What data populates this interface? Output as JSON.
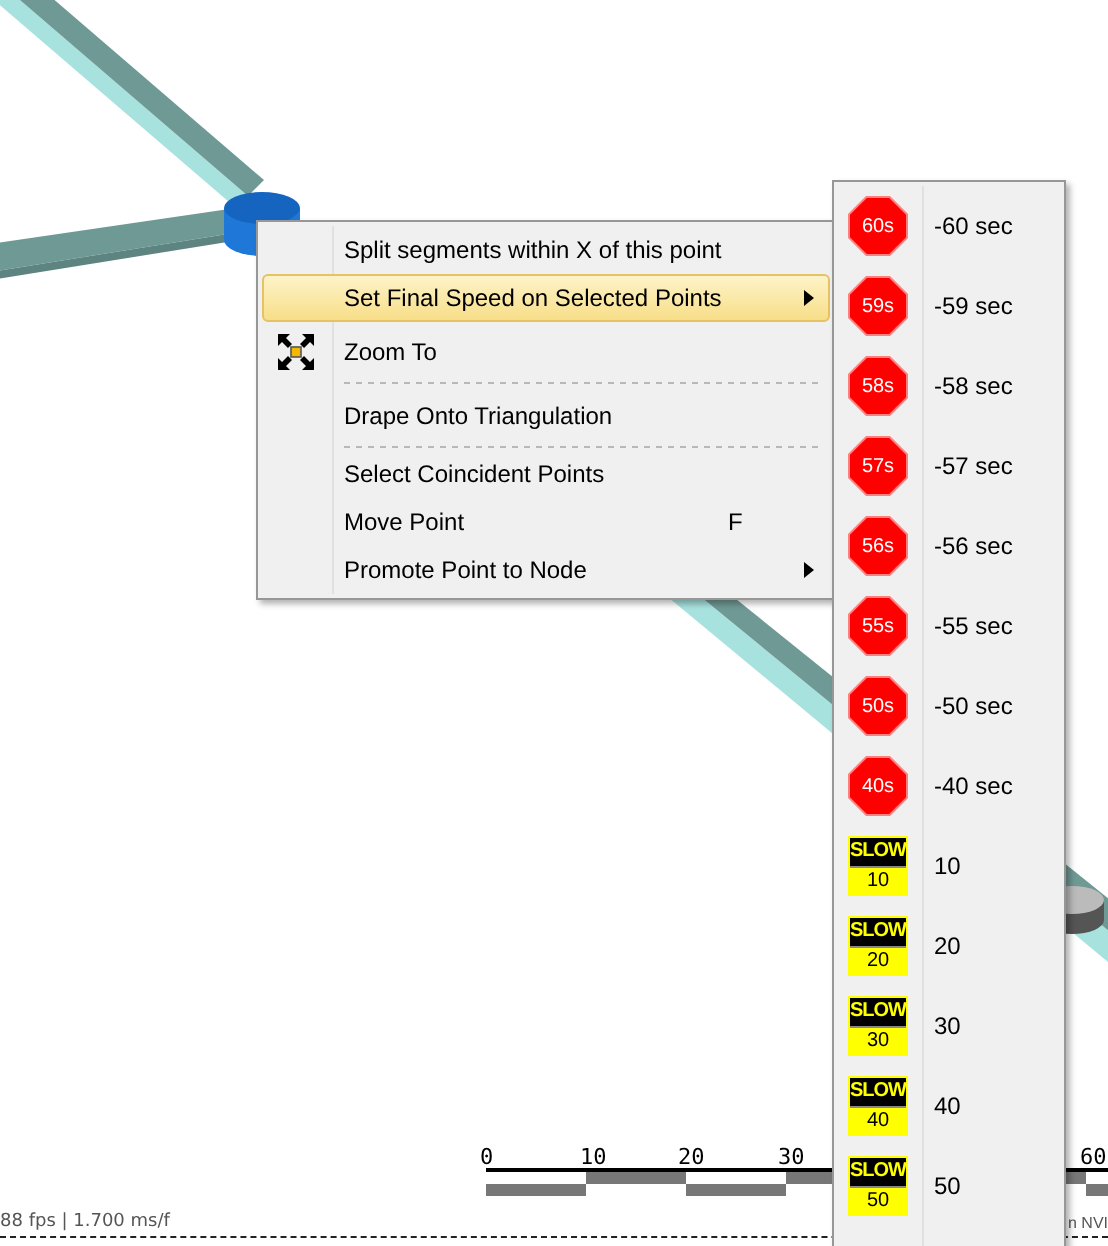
{
  "context_menu": {
    "items": [
      {
        "label": "Split segments within X of this point",
        "selected": false,
        "submenu": false,
        "separator_after": false
      },
      {
        "label": "Set Final Speed on Selected Points",
        "selected": true,
        "submenu": true,
        "separator_after": false
      },
      {
        "label": "Zoom To",
        "selected": false,
        "submenu": false,
        "kind": "zoom",
        "separator_after": true
      },
      {
        "label": "Drape Onto Triangulation",
        "selected": false,
        "submenu": false,
        "separator_after": true
      },
      {
        "label": "Select Coincident Points",
        "selected": false,
        "submenu": false,
        "separator_after": false
      },
      {
        "label": "Move Point",
        "shortcut": "F",
        "selected": false,
        "submenu": false,
        "separator_after": false
      },
      {
        "label": "Promote Point to Node",
        "selected": false,
        "submenu": true,
        "separator_after": false
      }
    ]
  },
  "speed_submenu": {
    "items": [
      {
        "kind": "stop",
        "sign": "60s",
        "label": "-60 sec"
      },
      {
        "kind": "stop",
        "sign": "59s",
        "label": "-59 sec"
      },
      {
        "kind": "stop",
        "sign": "58s",
        "label": "-58 sec"
      },
      {
        "kind": "stop",
        "sign": "57s",
        "label": "-57 sec"
      },
      {
        "kind": "stop",
        "sign": "56s",
        "label": "-56 sec"
      },
      {
        "kind": "stop",
        "sign": "55s",
        "label": "-55 sec"
      },
      {
        "kind": "stop",
        "sign": "50s",
        "label": "-50 sec"
      },
      {
        "kind": "stop",
        "sign": "40s",
        "label": "-40 sec"
      },
      {
        "kind": "slow",
        "sign": "SLOW",
        "sign_value": "10",
        "label": "10"
      },
      {
        "kind": "slow",
        "sign": "SLOW",
        "sign_value": "20",
        "label": "20"
      },
      {
        "kind": "slow",
        "sign": "SLOW",
        "sign_value": "30",
        "label": "30"
      },
      {
        "kind": "slow",
        "sign": "SLOW",
        "sign_value": "40",
        "label": "40"
      },
      {
        "kind": "slow",
        "sign": "SLOW",
        "sign_value": "50",
        "label": "50"
      }
    ]
  },
  "scale_bar": {
    "labels": [
      "0",
      "10",
      "20",
      "30",
      "60"
    ]
  },
  "status_bar": {
    "render_stats": "88 fps | 1.700 ms/f",
    "gpu_text": "n NVI"
  }
}
